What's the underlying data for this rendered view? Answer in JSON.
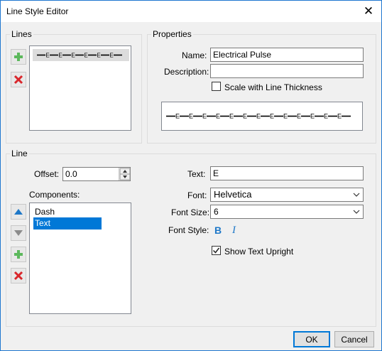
{
  "window": {
    "title": "Line Style Editor",
    "close_glyph": "✕"
  },
  "lines_group": {
    "label": "Lines",
    "items": [
      {
        "preview": "E—E—E—E—E—E"
      }
    ],
    "add_icon": "plus-icon",
    "remove_icon": "delete-x-icon"
  },
  "properties_group": {
    "label": "Properties",
    "name_label": "Name:",
    "name_value": "Electrical Pulse",
    "description_label": "Description:",
    "description_value": "",
    "scale_checkbox_label": "Scale with Line Thickness",
    "scale_checked": false
  },
  "preview_letter": "E",
  "line_group": {
    "label": "Line",
    "offset_label": "Offset:",
    "offset_value": "0.0",
    "components_label": "Components:",
    "components": [
      {
        "label": "Dash",
        "selected": false
      },
      {
        "label": "Text",
        "selected": true
      }
    ],
    "text_label": "Text:",
    "text_value": "E",
    "font_label": "Font:",
    "font_value": "Helvetica",
    "font_size_label": "Font Size:",
    "font_size_value": "6",
    "font_style_label": "Font Style:",
    "bold_glyph": "B",
    "italic_glyph": "I",
    "show_upright_label": "Show Text Upright",
    "show_upright_checked": true
  },
  "buttons": {
    "ok": "OK",
    "cancel": "Cancel"
  },
  "colors": {
    "accent": "#0078d7",
    "add_green": "#5cb85c",
    "remove_red": "#d9262b"
  }
}
